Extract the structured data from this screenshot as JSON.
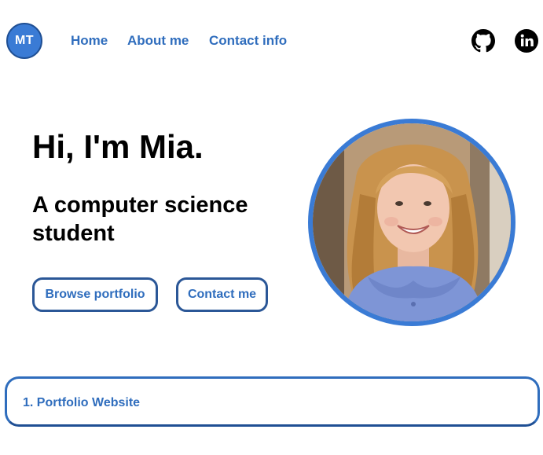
{
  "header": {
    "logo_initials": "MT",
    "nav": [
      {
        "label": "Home"
      },
      {
        "label": "About me"
      },
      {
        "label": "Contact info"
      }
    ],
    "social_icons": [
      "github-icon",
      "linkedin-icon"
    ]
  },
  "hero": {
    "greeting": "Hi, I'm Mia.",
    "subtitle": "A computer science student",
    "buttons": [
      {
        "label": "Browse portfolio"
      },
      {
        "label": "Contact me"
      }
    ],
    "photo_description": "portrait-photo"
  },
  "projects": [
    {
      "title": "1. Portfolio Website"
    }
  ],
  "colors": {
    "accent": "#2f6dbd",
    "accent_dark": "#1f4f94",
    "logo_bg": "#3a7bd5",
    "background": "#ffffff",
    "text": "#000000"
  }
}
